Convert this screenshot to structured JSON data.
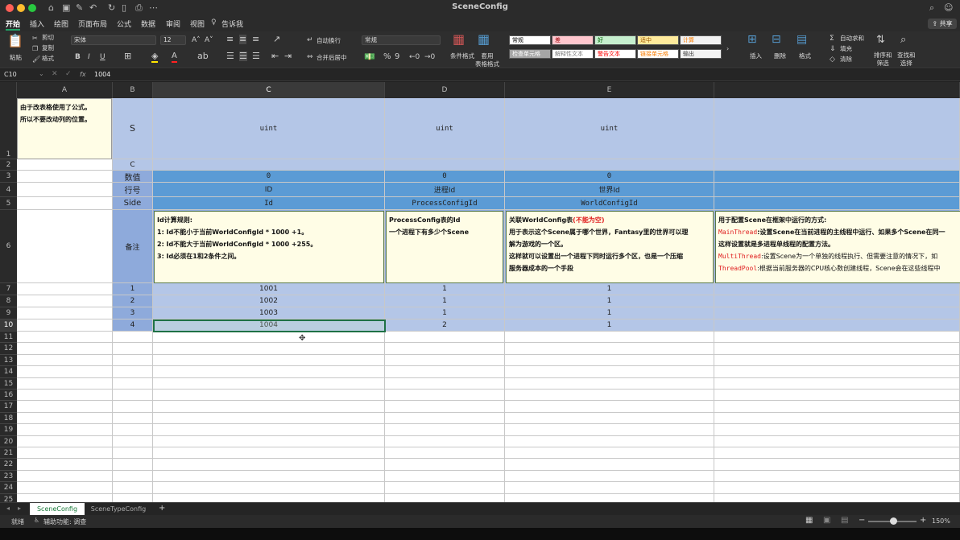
{
  "window": {
    "title": "SceneConfig",
    "share": "共享"
  },
  "menu": [
    "开始",
    "插入",
    "绘图",
    "页面布局",
    "公式",
    "数据",
    "审阅",
    "视图",
    "告诉我"
  ],
  "ribbon": {
    "paste": "粘贴",
    "cut": "剪切",
    "copy": "复制",
    "format_painter": "格式",
    "font_name": "宋体",
    "font_size": "12",
    "bold": "B",
    "italic": "I",
    "underline": "U",
    "wrap_text": "自动换行",
    "merge_center": "合并后居中",
    "number_format": "常规",
    "percent": "%",
    "comma": "9",
    "conditional_format": "条件格式",
    "table_format": "套用\n表格格式",
    "styles": [
      {
        "label": "常规",
        "bg": "#ffffff",
        "fg": "#000000"
      },
      {
        "label": "差",
        "bg": "#ffc7ce",
        "fg": "#9c0006"
      },
      {
        "label": "好",
        "bg": "#c6efce",
        "fg": "#006100"
      },
      {
        "label": "适中",
        "bg": "#ffeb9c",
        "fg": "#9c5700"
      },
      {
        "label": "计算",
        "bg": "#f2f2f2",
        "fg": "#fa7d00"
      },
      {
        "label": "检查单元格",
        "bg": "#a5a5a5",
        "fg": "#ffffff"
      },
      {
        "label": "解释性文本",
        "bg": "#ffffff",
        "fg": "#7f7f7f"
      },
      {
        "label": "警告文本",
        "bg": "#ffffff",
        "fg": "#ff0000"
      },
      {
        "label": "链接单元格",
        "bg": "#ffffff",
        "fg": "#fa7d00"
      },
      {
        "label": "输出",
        "bg": "#f2f2f2",
        "fg": "#3f3f3f"
      }
    ],
    "insert": "插入",
    "delete": "删除",
    "format": "格式",
    "autosum": "自动求和",
    "fill": "填充",
    "clear": "清除",
    "sort_filter": "排序和\n筛选",
    "find_select": "查找和\n选择"
  },
  "formula_bar": {
    "name_box": "C10",
    "fx": "fx",
    "value": "1004"
  },
  "columns": [
    "A",
    "B",
    "C",
    "D",
    "E"
  ],
  "rows": {
    "r1": {
      "A_note": "由于改表格使用了公式。\n所以不要改动列的位置。",
      "B": "S",
      "C": "uint",
      "D": "uint",
      "E": "uint"
    },
    "r2": {
      "B": "C"
    },
    "r3": {
      "B": "数值",
      "C": "0",
      "D": "0",
      "E": "0"
    },
    "r4": {
      "B": "行号",
      "C": "ID",
      "D": "进程Id",
      "E": "世界Id"
    },
    "r5": {
      "B": "Side",
      "C": "Id",
      "D": "ProcessConfigId",
      "E": "WorldConfigId"
    },
    "r6": {
      "B": "备注",
      "C_lines": [
        "Id计算规则:",
        "1: Id不能小于当前WorldConfigId * 1000 +1。",
        "2: Id不能大于当前WorldConfigId * 1000 +255。",
        "3: Id必须在1和2条件之间。"
      ],
      "D_lines": [
        "ProcessConfig表的Id",
        "一个进程下有多少个Scene"
      ],
      "E_title": "关联WorldConfig表",
      "E_warn": "(不能为空)",
      "E_lines": [
        "用于表示这个Scene属于哪个世界，Fantasy里的世界可以理",
        "解为游戏的一个区。",
        "这样就可以设置出一个进程下同时运行多个区，也是一个压缩",
        "服务器成本的一个手段"
      ],
      "F_lines": [
        "用于配置Scene在框架中运行的方式:",
        "MainThread:设置Scene在当前进程的主线程中运行、如果多个Scene在同一",
        "这样设置就是多进程单线程的配置方法。",
        "MultiThread:设置Scene为一个单独的线程执行、但需要注意的情况下，如",
        "ThreadPool:根据当前服务器的CPU核心数创建线程，Scene会在这些线程中"
      ]
    },
    "data": [
      {
        "B": "1",
        "C": "1001",
        "D": "1",
        "E": "1"
      },
      {
        "B": "2",
        "C": "1002",
        "D": "1",
        "E": "1"
      },
      {
        "B": "3",
        "C": "1003",
        "D": "1",
        "E": "1"
      },
      {
        "B": "4",
        "C": "1004",
        "D": "2",
        "E": "1"
      }
    ],
    "row_numbers": [
      "1",
      "2",
      "3",
      "4",
      "5",
      "6",
      "7",
      "8",
      "9",
      "10",
      "11",
      "12",
      "13",
      "14",
      "15",
      "16",
      "17",
      "18",
      "19",
      "20",
      "21",
      "22",
      "23",
      "24",
      "25"
    ]
  },
  "sheets": [
    "SceneConfig",
    "SceneTypeConfig"
  ],
  "status": {
    "ready": "就绪",
    "accessibility": "辅助功能: 调查",
    "zoom": "150%"
  },
  "colors": {
    "header_blue": "#b4c6e7",
    "mid_blue": "#8eaadb",
    "deep_blue": "#5b9bd5",
    "note_bg": "#fffde6",
    "red_text": "#e02020"
  }
}
